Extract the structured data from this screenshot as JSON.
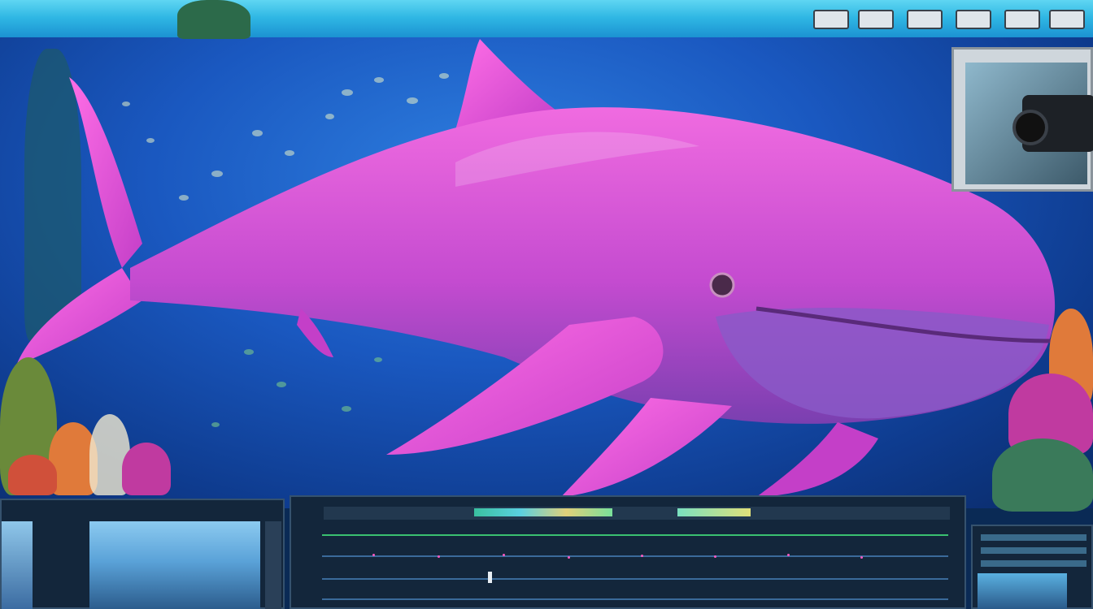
{
  "scene": {
    "subject": "",
    "colors": {
      "whale": "#d94fd6",
      "whale_shadow": "#7a3fb0",
      "water": "#1a58c0",
      "surface": "#2fb7e4",
      "panel": "#13263b"
    }
  }
}
